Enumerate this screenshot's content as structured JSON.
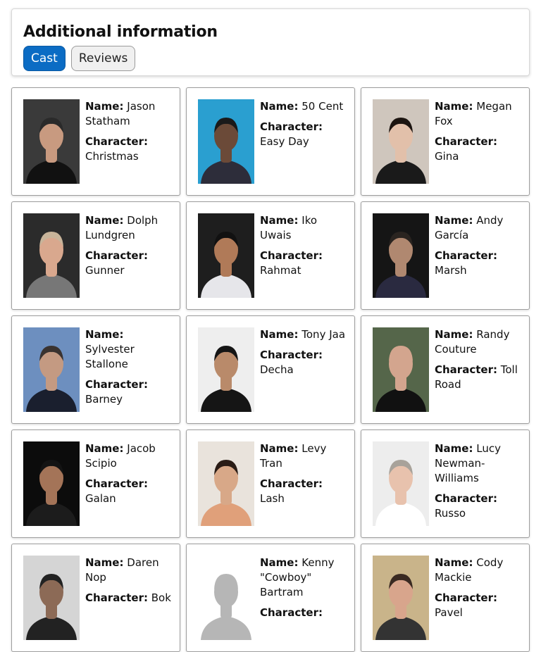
{
  "info": {
    "title": "Additional information",
    "tabs": [
      {
        "label": "Cast",
        "active": true
      },
      {
        "label": "Reviews",
        "active": false
      }
    ]
  },
  "labels": {
    "name": "Name:",
    "character": "Character:"
  },
  "colors": {
    "accent": "#0b6cc4"
  },
  "cast": [
    {
      "name": "Jason Statham",
      "character": "Christmas",
      "photo": "portrait",
      "bg": "#3a3a3a",
      "skin": "#c89a80",
      "hair": "#2a2a2a",
      "shirt": "#111111"
    },
    {
      "name": "50 Cent",
      "character": "Easy Day",
      "photo": "portrait",
      "bg": "#2a9fd0",
      "skin": "#6b4a38",
      "hair": "#1a1a1a",
      "shirt": "#2d2d3a"
    },
    {
      "name": "Megan Fox",
      "character": "Gina",
      "photo": "portrait",
      "bg": "#cfc6bd",
      "skin": "#e2c0aa",
      "hair": "#1c1410",
      "shirt": "#1a1a1a"
    },
    {
      "name": "Dolph Lundgren",
      "character": "Gunner",
      "photo": "portrait",
      "bg": "#2b2b2b",
      "skin": "#d9a88e",
      "hair": "#c8b49a",
      "shirt": "#777777"
    },
    {
      "name": "Iko Uwais",
      "character": "Rahmat",
      "photo": "portrait",
      "bg": "#1e1e1e",
      "skin": "#b07a58",
      "hair": "#111111",
      "shirt": "#e6e6ea"
    },
    {
      "name": "Andy García",
      "character": "Marsh",
      "photo": "portrait",
      "bg": "#151515",
      "skin": "#b08870",
      "hair": "#2a2420",
      "shirt": "#2a2a40"
    },
    {
      "name": "Sylvester Stallone",
      "character": "Barney",
      "photo": "portrait",
      "bg": "#6d8fbf",
      "skin": "#c49a82",
      "hair": "#3a3330",
      "shirt": "#1a1f2e"
    },
    {
      "name": "Tony Jaa",
      "character": "Decha",
      "photo": "portrait",
      "bg": "#eeeeee",
      "skin": "#b98a6a",
      "hair": "#151515",
      "shirt": "#151515"
    },
    {
      "name": "Randy Couture",
      "character": "Toll Road",
      "photo": "portrait",
      "bg": "#55664a",
      "skin": "#d3a58e",
      "hair": "#d3a58e",
      "shirt": "#111111"
    },
    {
      "name": "Jacob Scipio",
      "character": "Galan",
      "photo": "portrait",
      "bg": "#0c0c0c",
      "skin": "#a47458",
      "hair": "#141414",
      "shirt": "#1c1c1c"
    },
    {
      "name": "Levy Tran",
      "character": "Lash",
      "photo": "portrait",
      "bg": "#e9e3dc",
      "skin": "#d8a888",
      "hair": "#2a1c16",
      "shirt": "#e0a07a"
    },
    {
      "name": "Lucy Newman-Williams",
      "character": "Russo",
      "photo": "portrait",
      "bg": "#ededed",
      "skin": "#e8c2ad",
      "hair": "#a8a29a",
      "shirt": "#ffffff"
    },
    {
      "name": "Daren Nop",
      "character": "Bok",
      "photo": "portrait",
      "bg": "#d5d5d5",
      "skin": "#8c6a56",
      "hair": "#222222",
      "shirt": "#222222"
    },
    {
      "name": "Kenny \"Cowboy\" Bartram",
      "character": "",
      "photo": "placeholder",
      "bg": "#ffffff",
      "skin": "#b6b6b6",
      "hair": "#b6b6b6",
      "shirt": "#b6b6b6"
    },
    {
      "name": "Cody Mackie",
      "character": "Pavel",
      "photo": "portrait",
      "bg": "#c9b48a",
      "skin": "#d8a58c",
      "hair": "#3a2a22",
      "shirt": "#333333"
    }
  ]
}
